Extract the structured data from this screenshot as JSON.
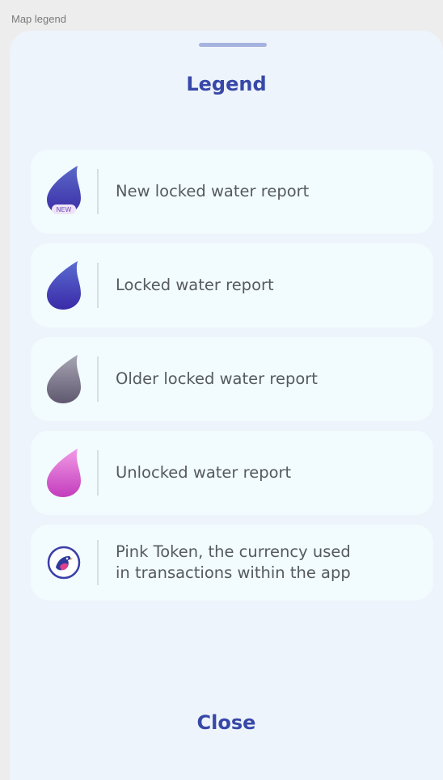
{
  "window": {
    "title": "Map legend"
  },
  "sheet": {
    "title": "Legend",
    "close_label": "Close"
  },
  "items": [
    {
      "label": "New locked water report",
      "icon": "water-drop-new-icon",
      "badge": "NEW",
      "color_top": "#5b6ac9",
      "color_bottom": "#3b2ca6"
    },
    {
      "label": "Locked water report",
      "icon": "water-drop-locked-icon",
      "color_top": "#5a6cd0",
      "color_bottom": "#3a2aa8"
    },
    {
      "label": "Older locked water report",
      "icon": "water-drop-older-icon",
      "color_top": "#a8a6b4",
      "color_bottom": "#5f586f"
    },
    {
      "label": "Unlocked water report",
      "icon": "water-drop-unlocked-icon",
      "color_top": "#f29be6",
      "color_bottom": "#c33cbd"
    },
    {
      "label_line1": "Pink Token, the currency used",
      "label_line2": "in transactions within the app",
      "icon": "pink-token-bird-icon"
    }
  ]
}
